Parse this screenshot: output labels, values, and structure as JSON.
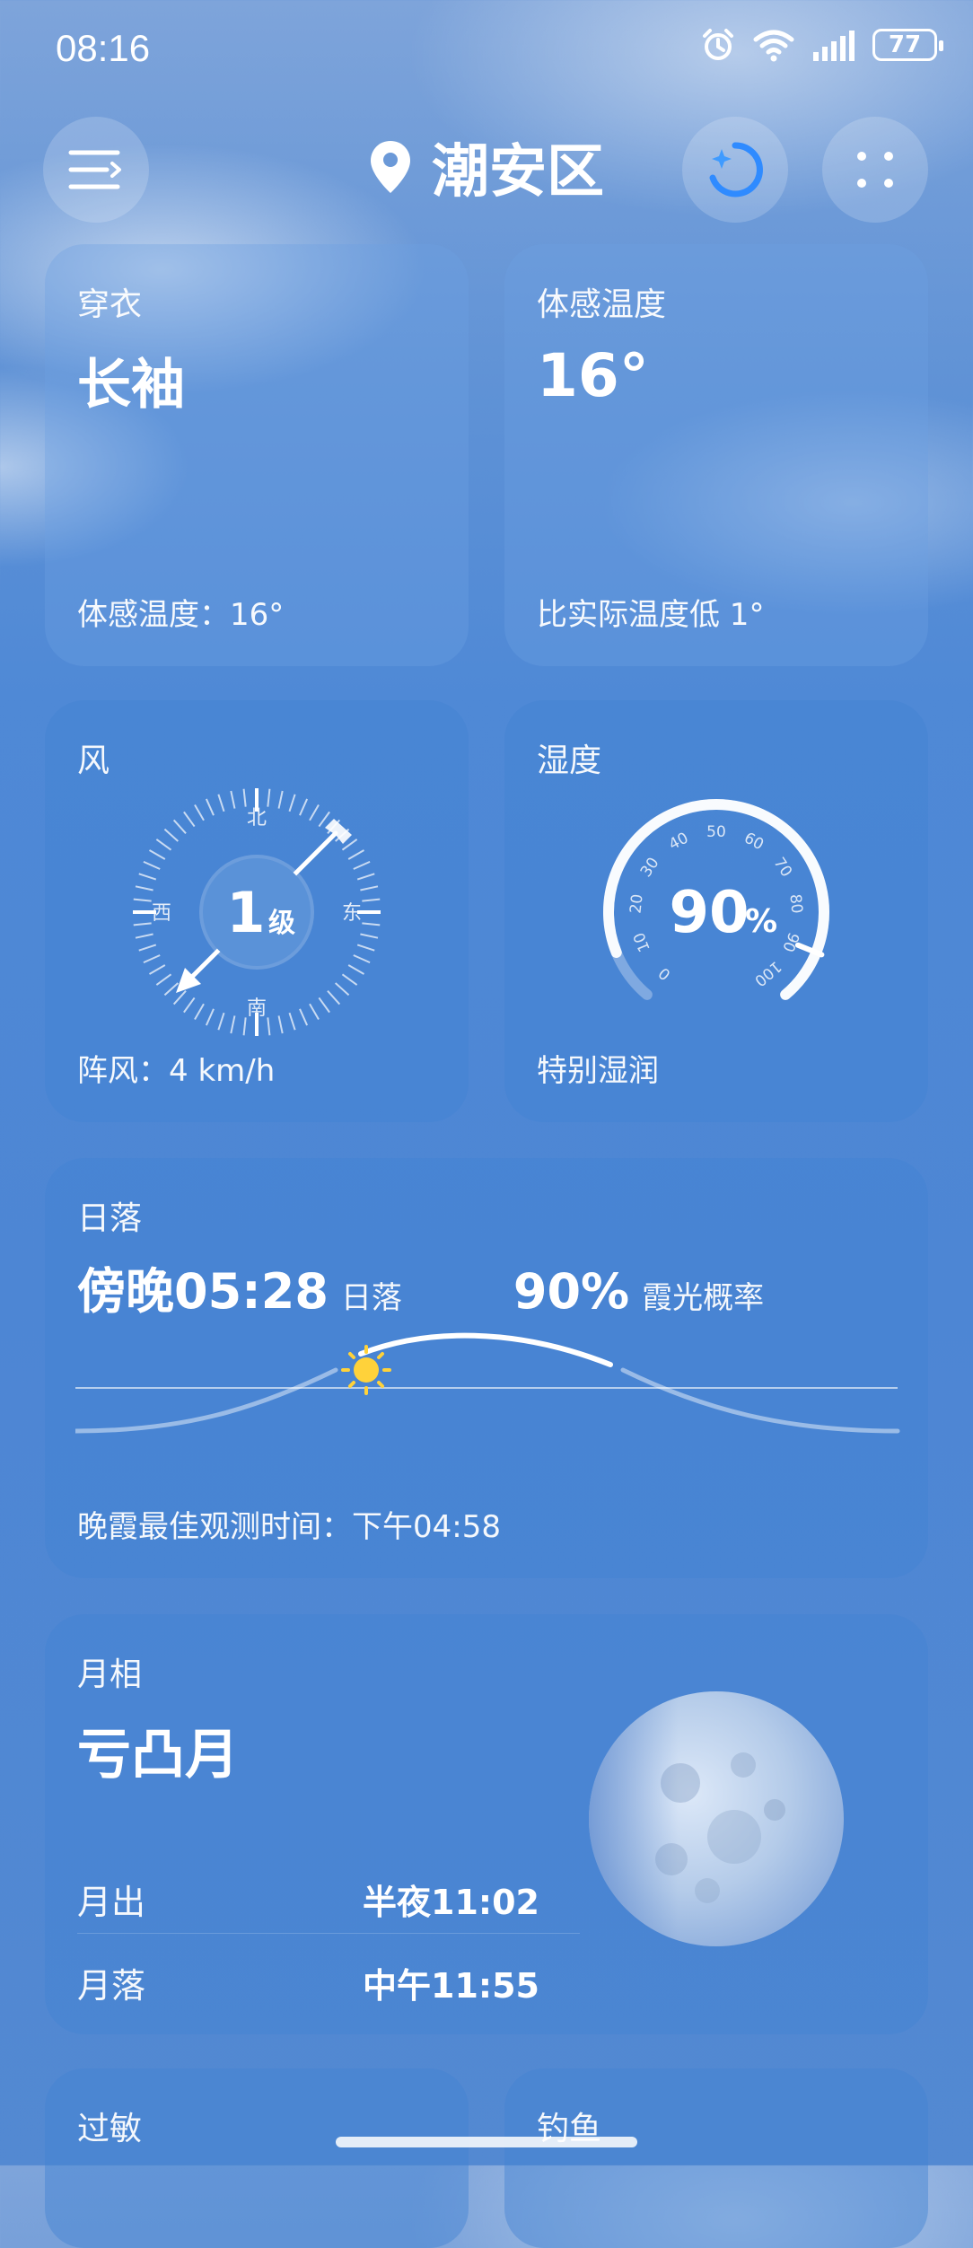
{
  "status_bar": {
    "time": "08:16",
    "battery": "77"
  },
  "header": {
    "location": "潮安区"
  },
  "cards": {
    "clothing": {
      "label": "穿衣",
      "value": "长袖",
      "footer": "体感温度：16°"
    },
    "feels_like": {
      "label": "体感温度",
      "value": "16°",
      "footer": "比实际温度低 1°"
    },
    "wind": {
      "label": "风",
      "level_number": "1",
      "level_unit": "级",
      "dir_north": "北",
      "dir_south": "南",
      "dir_east": "东",
      "dir_west": "西",
      "footer": "阵风：4 km/h"
    },
    "humidity": {
      "label": "湿度",
      "value": "90",
      "unit": "%",
      "percent": 90,
      "ticks": [
        "0",
        "10",
        "20",
        "30",
        "40",
        "50",
        "60",
        "70",
        "80",
        "90",
        "100"
      ],
      "footer": "特别湿润"
    },
    "sunset": {
      "label": "日落",
      "time": "傍晚05:28",
      "time_tag": "日落",
      "probability": "90%",
      "probability_tag": "霞光概率",
      "footer": "晚霞最佳观测时间：下午04:58"
    },
    "moon": {
      "label": "月相",
      "phase": "亏凸月",
      "rise_label": "月出",
      "rise_time": "半夜11:02",
      "set_label": "月落",
      "set_time": "中午11:55"
    },
    "allergy": {
      "label": "过敏"
    },
    "fishing": {
      "label": "钓鱼"
    }
  },
  "colors": {
    "sun": "#ffd23a",
    "accent": "#2f8bff"
  }
}
